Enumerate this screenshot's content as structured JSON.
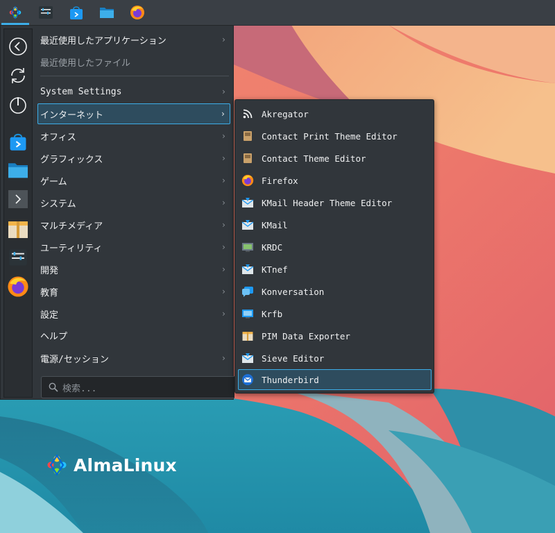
{
  "taskbar": {
    "items": [
      {
        "name": "application-launcher",
        "icon": "almalinux-logo-icon",
        "active": true
      },
      {
        "name": "system-settings",
        "icon": "settings-panel-icon",
        "active": false
      },
      {
        "name": "discover",
        "icon": "store-bag-icon",
        "active": false
      },
      {
        "name": "dolphin",
        "icon": "folder-icon",
        "active": false
      },
      {
        "name": "firefox",
        "icon": "firefox-icon",
        "active": false
      }
    ]
  },
  "favorites": [
    {
      "icon": "back-icon"
    },
    {
      "icon": "refresh-icon"
    },
    {
      "icon": "power-icon"
    },
    {
      "icon": "store-bag-icon"
    },
    {
      "icon": "folder-icon"
    },
    {
      "icon": "terminal-icon"
    },
    {
      "icon": "archive-icon"
    },
    {
      "icon": "settings-panel-icon"
    },
    {
      "icon": "firefox-icon"
    }
  ],
  "categories": [
    {
      "label": "最近使用したアプリケーション",
      "arrow": "›"
    },
    {
      "label": "最近使用したファイル",
      "arrow": ""
    },
    {
      "label": "System Settings",
      "arrow": "›"
    },
    {
      "label": "インターネット",
      "arrow": "›"
    },
    {
      "label": "オフィス",
      "arrow": "›"
    },
    {
      "label": "グラフィックス",
      "arrow": "›"
    },
    {
      "label": "ゲーム",
      "arrow": "›"
    },
    {
      "label": "システム",
      "arrow": "›"
    },
    {
      "label": "マルチメディア",
      "arrow": "›"
    },
    {
      "label": "ユーティリティ",
      "arrow": "›"
    },
    {
      "label": "開発",
      "arrow": "›"
    },
    {
      "label": "教育",
      "arrow": "›"
    },
    {
      "label": "設定",
      "arrow": "›"
    },
    {
      "label": "ヘルプ",
      "arrow": ""
    },
    {
      "label": "電源/セッション",
      "arrow": "›"
    }
  ],
  "search": {
    "placeholder": "検索..."
  },
  "internet_apps": [
    {
      "label": "Akregator",
      "icon": "rss-icon"
    },
    {
      "label": "Contact Print Theme Editor",
      "icon": "address-book-icon"
    },
    {
      "label": "Contact Theme Editor",
      "icon": "address-book-icon"
    },
    {
      "label": "Firefox",
      "icon": "firefox-icon"
    },
    {
      "label": "KMail Header Theme Editor",
      "icon": "mail-icon"
    },
    {
      "label": "KMail",
      "icon": "mail-icon"
    },
    {
      "label": "KRDC",
      "icon": "remote-desktop-icon"
    },
    {
      "label": "KTnef",
      "icon": "mail-icon"
    },
    {
      "label": "Konversation",
      "icon": "chat-icon"
    },
    {
      "label": "Krfb",
      "icon": "desktop-share-icon"
    },
    {
      "label": "PIM Data Exporter",
      "icon": "archive-icon"
    },
    {
      "label": "Sieve Editor",
      "icon": "mail-icon"
    },
    {
      "label": "Thunderbird",
      "icon": "thunderbird-icon"
    }
  ],
  "desktop": {
    "logo_text": "AlmaLinux"
  },
  "colors": {
    "accent": "#3daee9",
    "panel": "#31363b"
  }
}
